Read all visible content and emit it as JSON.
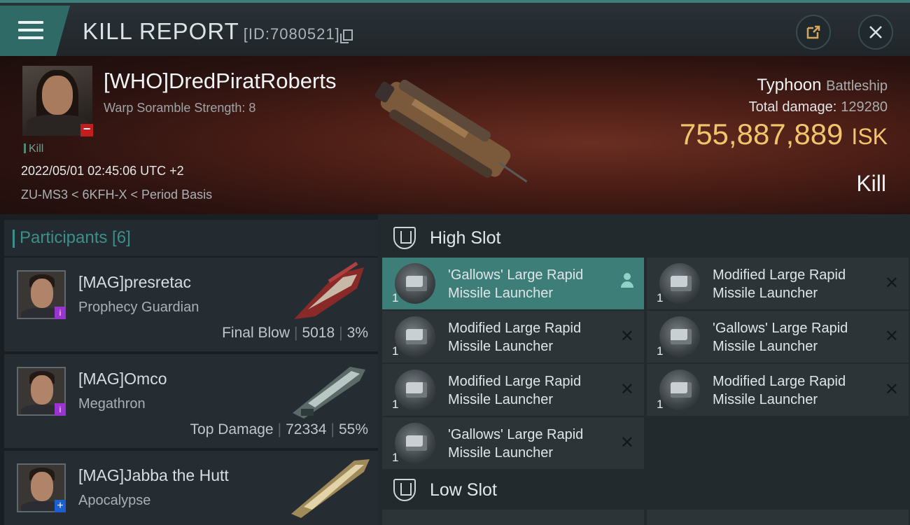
{
  "header": {
    "title": "KILL REPORT",
    "report_id": "[ID:7080521]"
  },
  "victim": {
    "name": "[WHO]DredPiratRoberts",
    "subtitle": "Warp Soramble Strength: 8",
    "kill_tag": "Kill",
    "datetime": "2022/05/01 02:45:06 UTC +2",
    "location": "ZU-MS3 < 6KFH-X < Period Basis",
    "ship_name": "Typhoon",
    "ship_class": "Battleship",
    "total_damage_label": "Total damage:",
    "total_damage": "129280",
    "isk_value": "755,887,889",
    "isk_unit": "ISK",
    "kill_type": "Kill"
  },
  "participants": {
    "title": "Participants [6]",
    "rows": [
      {
        "name": "[MAG]presretac",
        "ship": "Prophecy Guardian",
        "role": "Final Blow",
        "damage": "5018",
        "percent": "3%",
        "badge": "i"
      },
      {
        "name": "[MAG]Omco",
        "ship": "Megathron",
        "role": "Top Damage",
        "damage": "72334",
        "percent": "55%",
        "badge": "i"
      },
      {
        "name": "[MAG]Jabba the Hutt",
        "ship": "Apocalypse",
        "badge": "+"
      }
    ]
  },
  "slots": {
    "high_label": "High Slot",
    "low_label": "Low Slot",
    "high": [
      {
        "name": "'Gallows' Large Rapid Missile Launcher",
        "qty": "1"
      },
      {
        "name": "Modified Large Rapid Missile Launcher",
        "qty": "1"
      },
      {
        "name": "Modified Large Rapid Missile Launcher",
        "qty": "1"
      },
      {
        "name": "'Gallows' Large Rapid Missile Launcher",
        "qty": "1"
      },
      {
        "name": "Modified Large Rapid Missile Launcher",
        "qty": "1"
      },
      {
        "name": "Modified Large Rapid Missile Launcher",
        "qty": "1"
      },
      {
        "name": "'Gallows' Large Rapid Missile Launcher",
        "qty": "1"
      }
    ]
  },
  "icons": {
    "menu": "hamburger-icon",
    "share": "external-link-icon",
    "close": "close-icon",
    "slot": "slot-icon",
    "pilot": "pilot-icon",
    "destroyed": "x-icon"
  },
  "colors": {
    "accent": "#3e7e79",
    "isk": "#f0c56b",
    "victim_bg": "#4b1e16"
  }
}
